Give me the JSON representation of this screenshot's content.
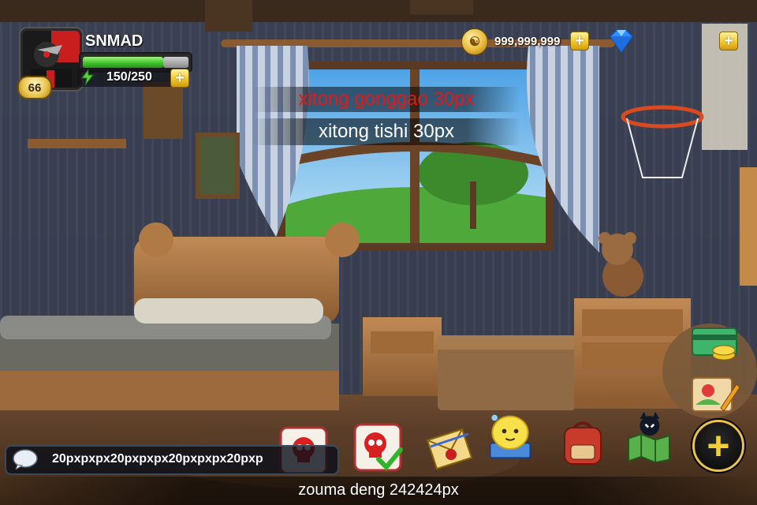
{
  "player": {
    "name": "SNMAD",
    "level": "66",
    "energy_text": "150/250",
    "hp_fraction": 0.76
  },
  "currency": {
    "gold": "999,999,999",
    "gold_icon_glyph": "☯"
  },
  "notices": {
    "announcement": "xitong gonggao 30px",
    "tip": "xitong tishi  30px"
  },
  "chat": {
    "message": "20pxpxpx20pxpxpx20pxpxpx20pxp"
  },
  "marquee": {
    "text": "zouma deng 242424px"
  },
  "menu": {
    "buttons": [
      {
        "name": "skull-red-icon"
      },
      {
        "name": "skull-check-icon"
      },
      {
        "name": "mail-icon"
      },
      {
        "name": "pet-book-icon"
      },
      {
        "name": "backpack-icon"
      },
      {
        "name": "map-icon"
      },
      {
        "name": "recharge-card-icon"
      },
      {
        "name": "draw-card-icon"
      }
    ],
    "add_label": "+"
  },
  "colors": {
    "announcement": "#e31818",
    "gold_accent": "#f2c92c",
    "hp_green": "#3bbf2a"
  }
}
